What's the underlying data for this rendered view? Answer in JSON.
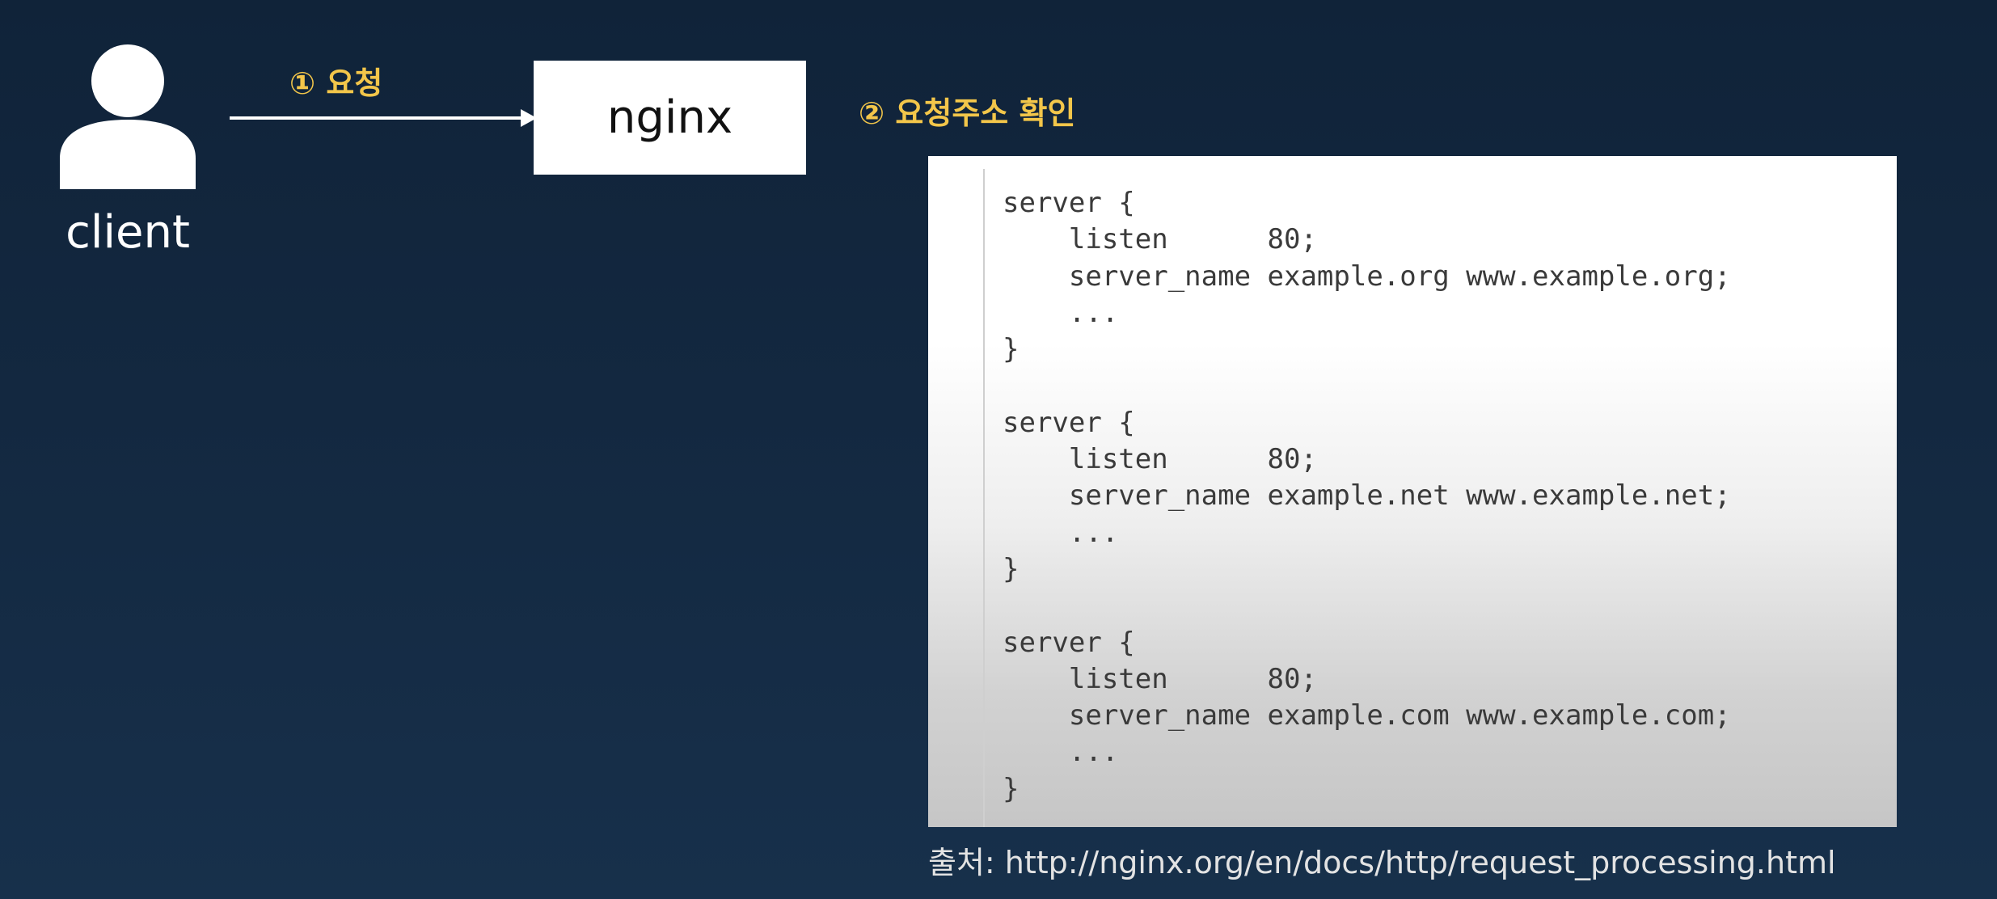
{
  "client": {
    "label": "client"
  },
  "step1": {
    "label": "① 요청"
  },
  "server_box": {
    "label": "nginx"
  },
  "step2": {
    "label": "② 요청주소 확인"
  },
  "config": {
    "code": "server {\n    listen      80;\n    server_name example.org www.example.org;\n    ...\n}\n\nserver {\n    listen      80;\n    server_name example.net www.example.net;\n    ...\n}\n\nserver {\n    listen      80;\n    server_name example.com www.example.com;\n    ...\n}"
  },
  "source": {
    "text": "출처: http://nginx.org/en/docs/http/request_processing.html"
  },
  "colors": {
    "background": "#132840",
    "accent": "#f3c64a",
    "panel": "#ffffff"
  },
  "icons": {
    "client": "person-icon",
    "arrow": "arrow-right-icon"
  }
}
